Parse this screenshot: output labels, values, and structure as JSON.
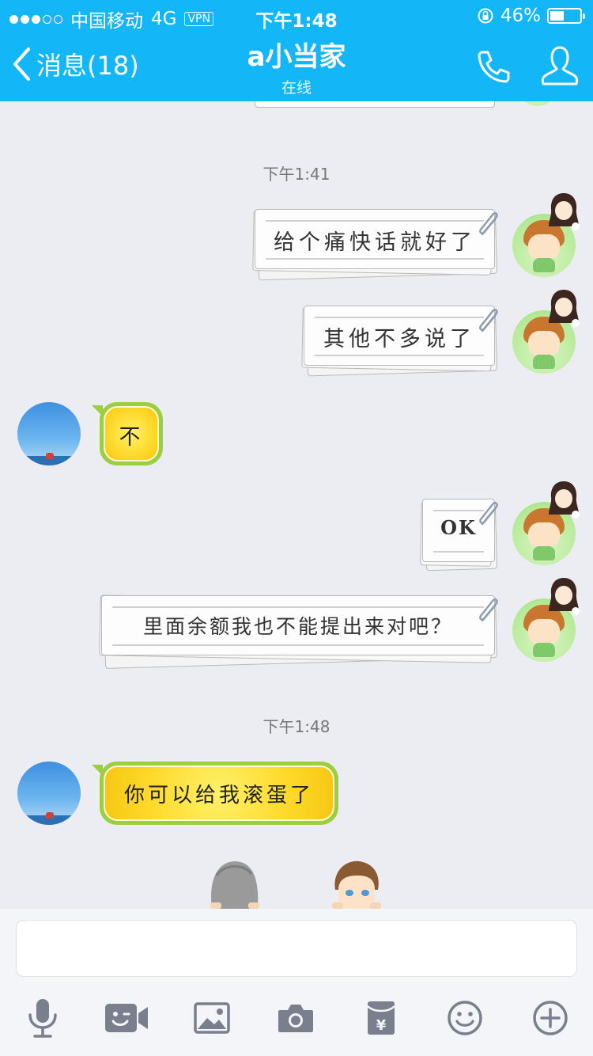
{
  "status_bar": {
    "carrier": "中国移动",
    "network": "4G",
    "vpn": "VPN",
    "time": "下午1:48",
    "battery": "46%",
    "battery_level": 0.46
  },
  "nav": {
    "back_label": "消息(18)",
    "title": "a小当家",
    "subtitle": "在线"
  },
  "messages": [
    {
      "type": "timestamp",
      "text": "下午1:41"
    },
    {
      "type": "sent",
      "text": "给个痛快话就好了"
    },
    {
      "type": "sent",
      "text": "其他不多说了"
    },
    {
      "type": "received",
      "text": "不"
    },
    {
      "type": "sent",
      "text": "OK"
    },
    {
      "type": "sent",
      "text": "里面余额我也不能提出来对吧？"
    },
    {
      "type": "timestamp",
      "text": "下午1:48"
    },
    {
      "type": "received",
      "text": "你可以给我滚蛋了"
    }
  ],
  "input": {
    "value": ""
  },
  "toolbar": [
    "microphone-icon",
    "video-icon",
    "image-icon",
    "camera-icon",
    "red-packet-icon",
    "emoji-icon",
    "plus-icon"
  ],
  "colors": {
    "nav_bg": "#13b6f7",
    "chat_bg": "#ebedf3",
    "lemon_border": "#9bcf3f",
    "lemon_fill": "#ffd92a"
  }
}
